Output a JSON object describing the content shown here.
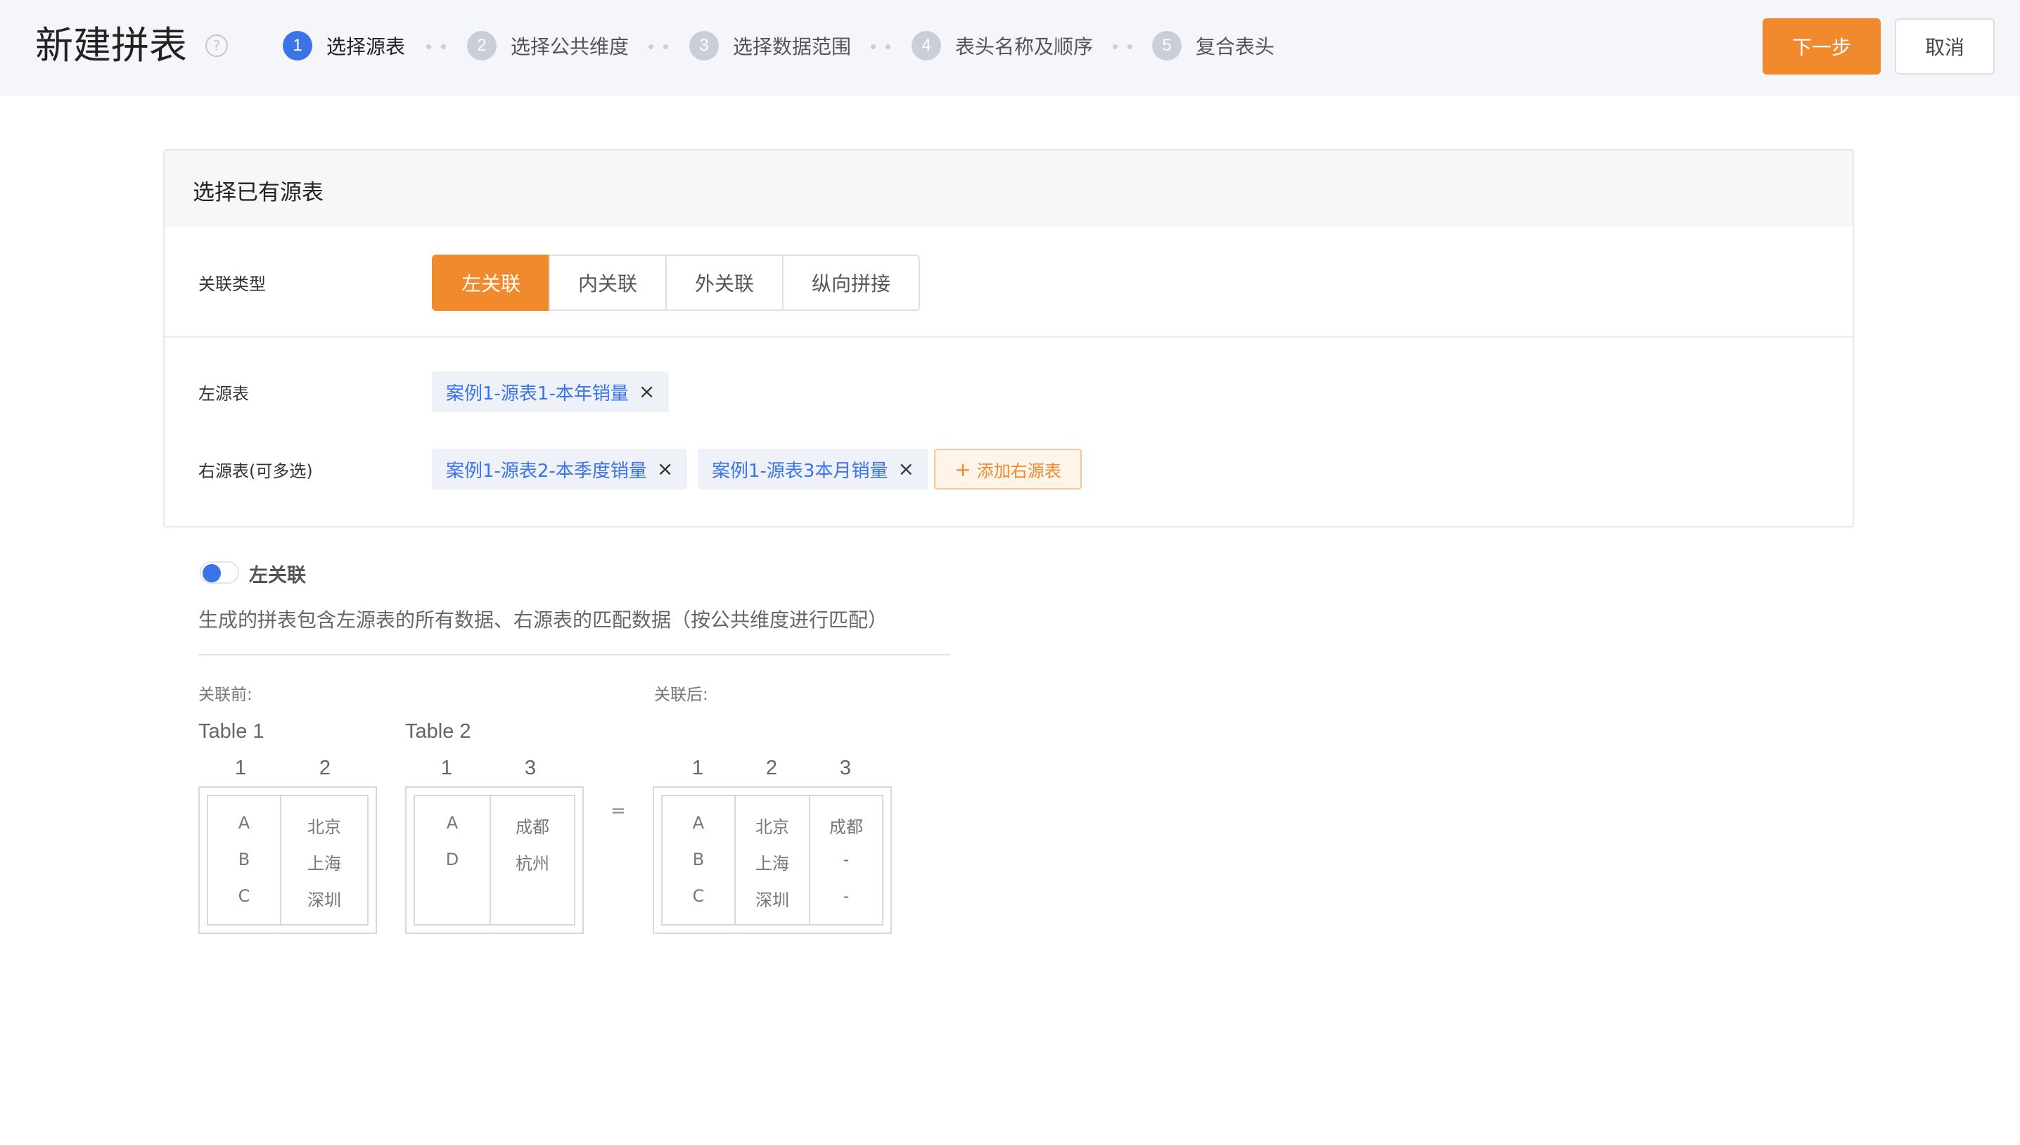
{
  "header": {
    "title": "新建拼表",
    "help_icon": "question-circle-icon",
    "steps": [
      {
        "num": "1",
        "label": "选择源表",
        "active": true
      },
      {
        "num": "2",
        "label": "选择公共维度",
        "active": false
      },
      {
        "num": "3",
        "label": "选择数据范围",
        "active": false
      },
      {
        "num": "4",
        "label": "表头名称及顺序",
        "active": false
      },
      {
        "num": "5",
        "label": "复合表头",
        "active": false
      }
    ],
    "next_label": "下一步",
    "cancel_label": "取消"
  },
  "colors": {
    "accent": "#f08a2c",
    "primary": "#3b74e8",
    "header_bg": "#f5f6f9"
  },
  "card": {
    "title": "选择已有源表",
    "join_type_label": "关联类型",
    "join_types": [
      "左关联",
      "内关联",
      "外关联",
      "纵向拼接"
    ],
    "selected_join_type": "左关联",
    "left_source_label": "左源表",
    "left_sources": [
      {
        "name": "案例1-源表1-本年销量"
      }
    ],
    "right_source_label": "右源表(可多选)",
    "right_sources": [
      {
        "name": "案例1-源表2-本季度销量"
      },
      {
        "name": "案例1-源表3本月销量"
      }
    ],
    "add_right_label": "添加右源表",
    "close_icon": "close-icon",
    "plus_icon": "plus-icon"
  },
  "explanation": {
    "title": "左关联",
    "description": "生成的拼表包含左源表的所有数据、右源表的匹配数据（按公共维度进行匹配）",
    "before_label": "关联前:",
    "after_label": "关联后:",
    "equals": "=",
    "table1": {
      "title": "Table 1",
      "columns": [
        "1",
        "2"
      ],
      "rows": [
        [
          "A",
          "北京"
        ],
        [
          "B",
          "上海"
        ],
        [
          "C",
          "深圳"
        ]
      ]
    },
    "table2": {
      "title": "Table 2",
      "columns": [
        "1",
        "3"
      ],
      "rows": [
        [
          "A",
          "成都"
        ],
        [
          "D",
          "杭州"
        ]
      ]
    },
    "result": {
      "columns": [
        "1",
        "2",
        "3"
      ],
      "rows": [
        [
          "A",
          "北京",
          "成都"
        ],
        [
          "B",
          "上海",
          "-"
        ],
        [
          "C",
          "深圳",
          "-"
        ]
      ]
    }
  }
}
